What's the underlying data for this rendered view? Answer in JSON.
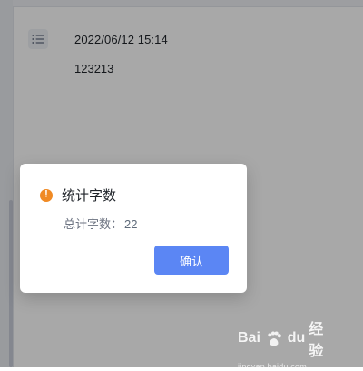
{
  "editor": {
    "timestamp": "2022/06/12 15:14",
    "content": "123213"
  },
  "dialog": {
    "title": "统计字数",
    "body_label": "总计字数：",
    "body_value": "22",
    "confirm_label": "确认"
  },
  "watermark": {
    "brand_left": "Bai",
    "brand_mid": "du",
    "brand_right": "经验",
    "domain": "jingyan.baidu.com"
  },
  "icons": {
    "list": "list-icon",
    "warning": "warning-circle-icon",
    "watermark_logo": "baidu-paw-icon"
  },
  "colors": {
    "overlay": "#000000",
    "primary": "#5b86f4",
    "warning": "#f08a24",
    "text": "#1f2329",
    "muted": "#6b7280"
  }
}
